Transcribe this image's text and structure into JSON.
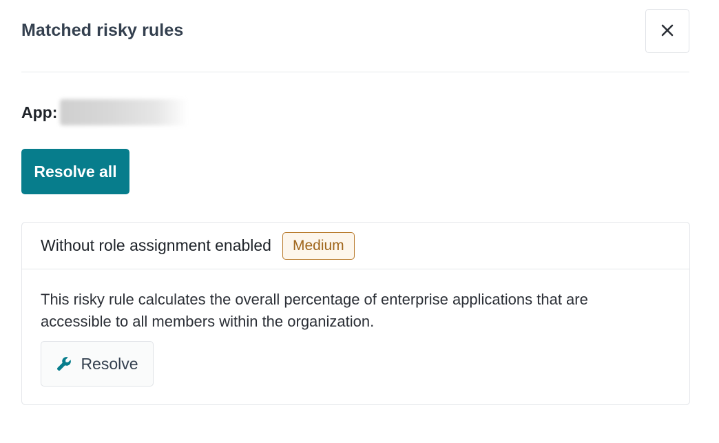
{
  "header": {
    "title": "Matched risky rules",
    "close_icon": "close-icon"
  },
  "app": {
    "label": "App:",
    "value": ""
  },
  "actions": {
    "resolve_all_label": "Resolve all"
  },
  "rules": [
    {
      "name": "Without role assignment enabled",
      "severity": "Medium",
      "description": "This risky rule calculates the overall percentage of enterprise applications that are accessible to all members within the organization.",
      "resolve_label": "Resolve",
      "resolve_icon": "wrench-icon"
    }
  ],
  "colors": {
    "primary": "#077d8c",
    "severity_medium_text": "#a0661c",
    "severity_medium_border": "#b8792a",
    "severity_medium_bg": "#fdf6ec",
    "title": "#34404f"
  }
}
